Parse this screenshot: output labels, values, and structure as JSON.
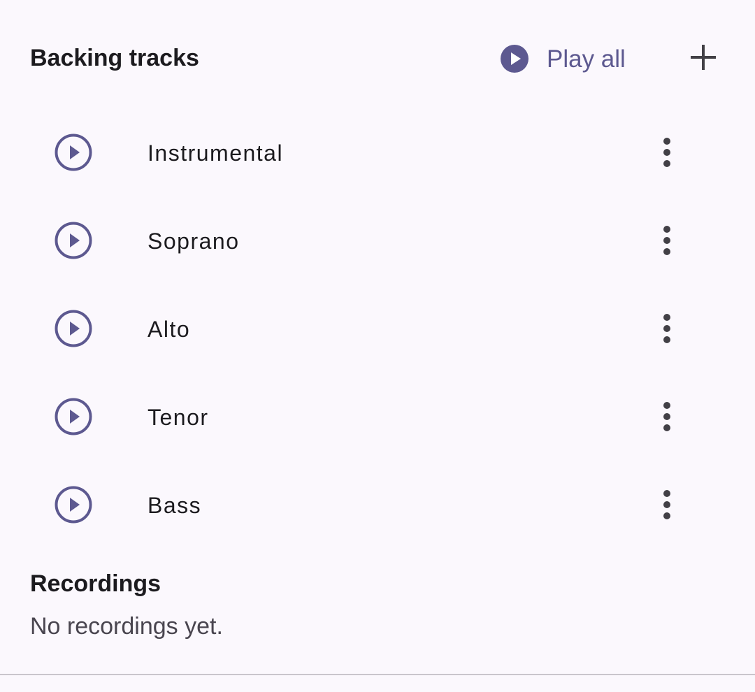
{
  "backing_tracks": {
    "title": "Backing tracks",
    "play_all_label": "Play all",
    "add_icon": "plus-icon",
    "play_all_icon": "play-circle-filled-icon",
    "tracks": [
      {
        "name": "Instrumental",
        "icon": "play-circle-outline-icon"
      },
      {
        "name": "Soprano",
        "icon": "play-circle-outline-icon"
      },
      {
        "name": "Alto",
        "icon": "play-circle-outline-icon"
      },
      {
        "name": "Tenor",
        "icon": "play-circle-outline-icon"
      },
      {
        "name": "Bass",
        "icon": "play-circle-outline-icon"
      }
    ]
  },
  "recordings": {
    "title": "Recordings",
    "empty_message": "No recordings yet."
  },
  "colors": {
    "accent": "#5d5990",
    "background": "#fbf8fd",
    "text_primary": "#1c1b1f",
    "text_secondary": "#49454f",
    "icon_dark": "#424046"
  }
}
